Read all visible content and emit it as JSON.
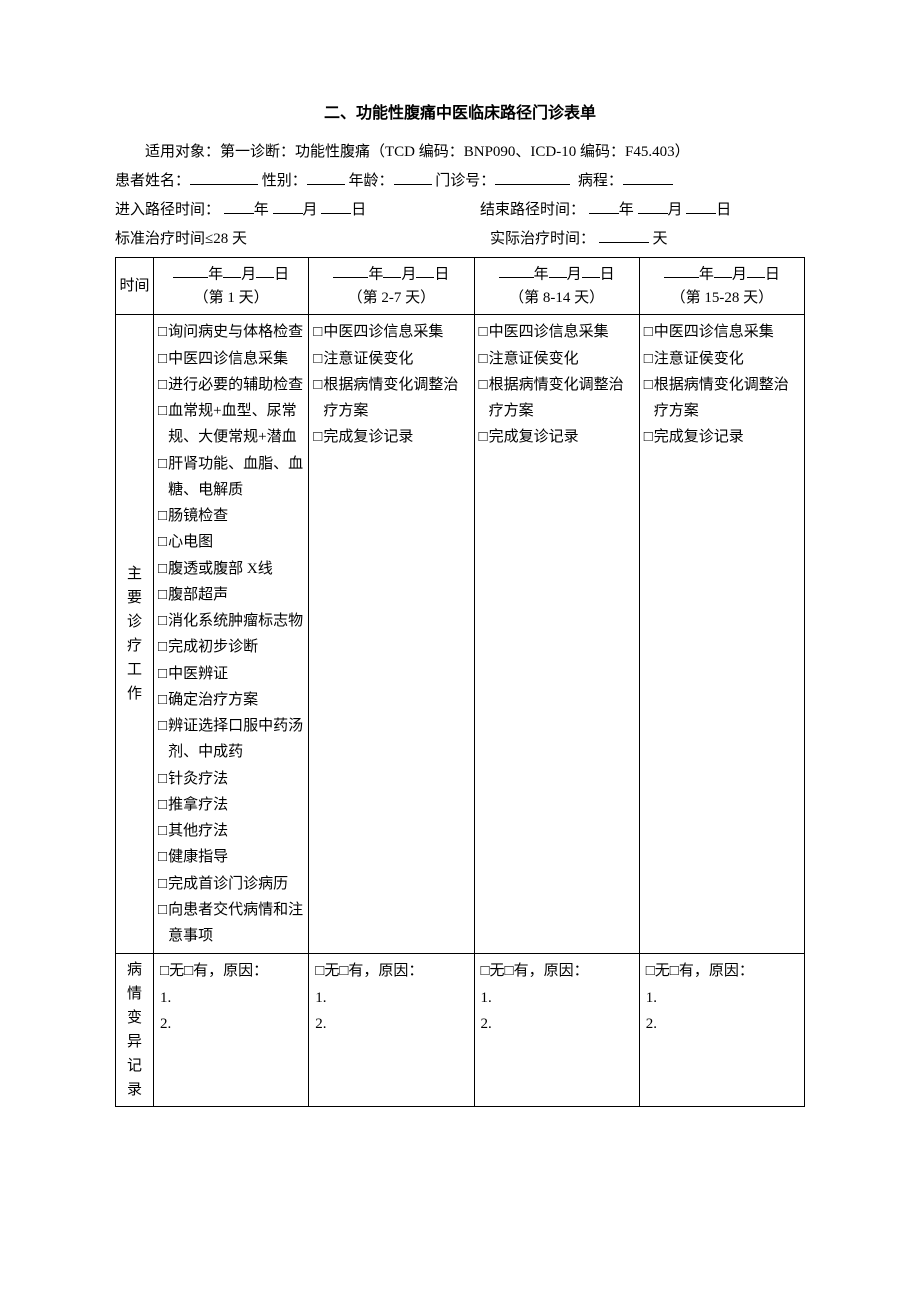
{
  "title": "二、功能性腹痛中医临床路径门诊表单",
  "applies_to": "适用对象：第一诊断：功能性腹痛（TCD 编码：BNP090、ICD-10 编码：F45.403）",
  "patient_line": {
    "name_label": "患者姓名：",
    "sex_label": "性别：",
    "age_label": "年龄：",
    "visit_no_label": "门诊号：",
    "course_label": "病程："
  },
  "enter_path_label": "进入路径时间：",
  "end_path_label": "结束路径时间：",
  "year": "年",
  "month": "月",
  "day": "日",
  "std_time_label": "标准治疗时间≤28 天",
  "actual_time_label": "实际治疗时间：",
  "days_unit": "天",
  "row_time": "时间",
  "row_work": "主要诊疗工作",
  "row_variation": "病情变异记录",
  "columns": [
    {
      "day_label": "（第 1 天）"
    },
    {
      "day_label": "（第 2-7 天）"
    },
    {
      "day_label": "（第 8-14 天）"
    },
    {
      "day_label": "（第 15-28 天）"
    }
  ],
  "work_col1": [
    "询问病史与体格检查",
    "中医四诊信息采集",
    "进行必要的辅助检查",
    "血常规+血型、尿常规、大便常规+潜血",
    "肝肾功能、血脂、血糖、电解质",
    "肠镜检查",
    "心电图",
    "腹透或腹部 X线",
    "腹部超声",
    "消化系统肿瘤标志物",
    "完成初步诊断",
    "中医辨证",
    "确定治疗方案",
    "辨证选择口服中药汤剂、中成药",
    "针灸疗法",
    "推拿疗法",
    "其他疗法",
    "健康指导",
    "完成首诊门诊病历",
    "向患者交代病情和注意事项"
  ],
  "work_col_other": [
    "中医四诊信息采集",
    "注意证侯变化",
    "根据病情变化调整治疗方案",
    "完成复诊记录"
  ],
  "variation": {
    "prefix_none": "□无□有，原因：",
    "line1": "1.",
    "line2": "2."
  },
  "checkbox": "□"
}
